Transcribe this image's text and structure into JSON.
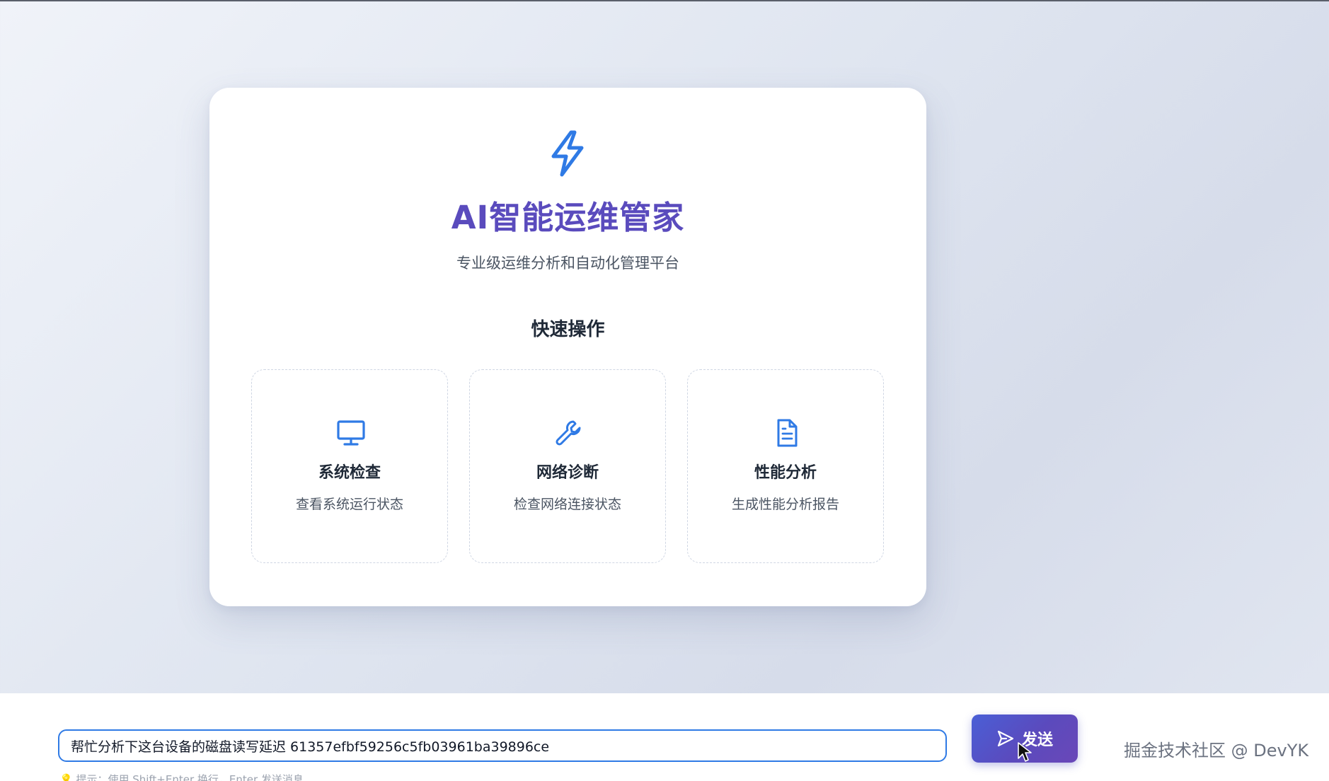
{
  "header": {
    "title": "AI智能运维管家",
    "subtitle": "专业级运维分析和自动化管理平台",
    "logo_icon": "lightning-bolt-icon"
  },
  "quick_actions": {
    "title": "快速操作",
    "items": [
      {
        "icon": "monitor-icon",
        "label": "系统检查",
        "desc": "查看系统运行状态"
      },
      {
        "icon": "wrench-icon",
        "label": "网络诊断",
        "desc": "检查网络连接状态"
      },
      {
        "icon": "document-icon",
        "label": "性能分析",
        "desc": "生成性能分析报告"
      }
    ]
  },
  "chat": {
    "input_value": "帮忙分析下这台设备的磁盘读写延迟 61357efbf59256c5fb03961ba39896ce",
    "send_label": "发送",
    "hint": "💡 提示：使用 Shift+Enter 换行，Enter 发送消息"
  },
  "watermark": "掘金技术社区 @ DevYK",
  "colors": {
    "accent": "#2f7ae5",
    "title": "#5a4bbd",
    "button_gradient_start": "#4a5fd6",
    "button_gradient_end": "#6a48b8"
  }
}
